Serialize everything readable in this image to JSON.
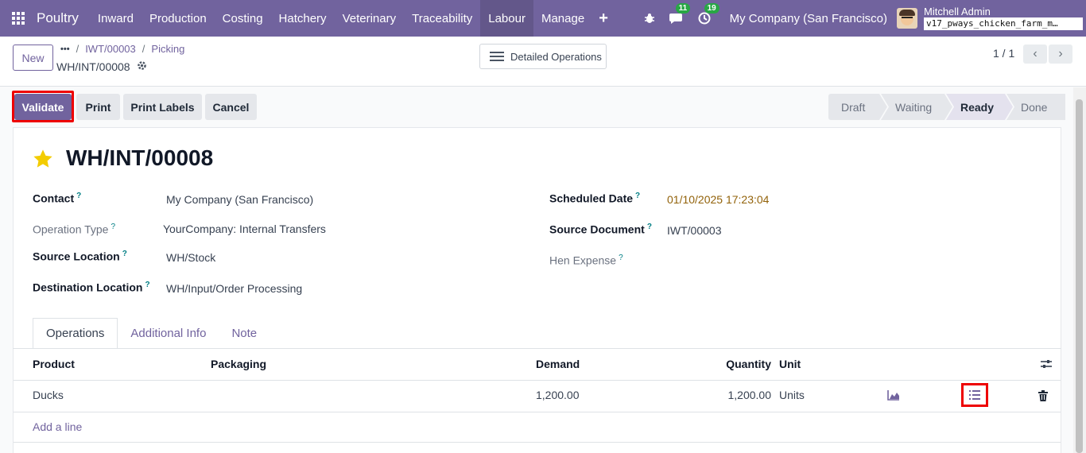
{
  "navbar": {
    "brand": "Poultry",
    "menu": [
      "Inward",
      "Production",
      "Costing",
      "Hatchery",
      "Veterinary",
      "Traceability",
      "Labour",
      "Manage"
    ],
    "active_menu": "Labour",
    "messages_count": "11",
    "activities_count": "19",
    "company": "My Company (San Francisco)",
    "user": "Mitchell Admin",
    "database": "v17_pways_chicken_farm_m…",
    "accent": "#71639e"
  },
  "control": {
    "new_label": "New",
    "breadcrumb_more": "•••",
    "breadcrumb_1": "IWT/00003",
    "breadcrumb_2": "Picking",
    "record_name": "WH/INT/00008",
    "detailed_label": "Detailed Operations",
    "pager": "1 / 1"
  },
  "actions": {
    "validate": "Validate",
    "print": "Print",
    "print_labels": "Print Labels",
    "cancel": "Cancel"
  },
  "stages": [
    "Draft",
    "Waiting",
    "Ready",
    "Done"
  ],
  "active_stage": "Ready",
  "form": {
    "title": "WH/INT/00008",
    "contact_label": "Contact",
    "contact": "My Company (San Francisco)",
    "operation_type_label": "Operation Type",
    "operation_type": "YourCompany: Internal Transfers",
    "source_location_label": "Source Location",
    "source_location": "WH/Stock",
    "destination_location_label": "Destination Location",
    "destination_location": "WH/Input/Order Processing",
    "scheduled_date_label": "Scheduled Date",
    "scheduled_date": "01/10/2025 17:23:04",
    "source_document_label": "Source Document",
    "source_document": "IWT/00003",
    "hen_expense_label": "Hen Expense",
    "help_mark": "?"
  },
  "tabs": [
    "Operations",
    "Additional Info",
    "Note"
  ],
  "table": {
    "headers": {
      "product": "Product",
      "packaging": "Packaging",
      "demand": "Demand",
      "quantity": "Quantity",
      "unit": "Unit"
    },
    "rows": [
      {
        "product": "Ducks",
        "packaging": "",
        "demand": "1,200.00",
        "quantity": "1,200.00",
        "unit": "Units"
      }
    ],
    "add_line": "Add a line"
  }
}
